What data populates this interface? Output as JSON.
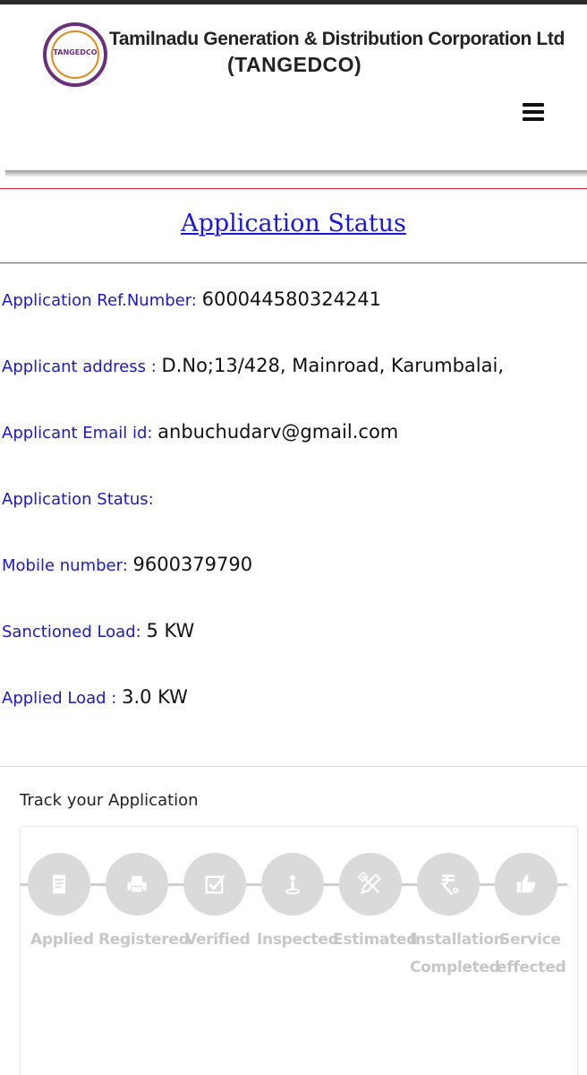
{
  "header": {
    "logo_text": "TANGEDCO",
    "org_name": "Tamilnadu Generation & Distribution Corporation Ltd",
    "org_abbr": "(TANGEDCO)"
  },
  "page": {
    "title": "Application Status"
  },
  "details": [
    {
      "label": "Application Ref.Number: ",
      "value": "600044580324241"
    },
    {
      "label": "Applicant address : ",
      "value": "D.No;13/428, Mainroad, Karumbalai,"
    },
    {
      "label": "Applicant Email id: ",
      "value": "anbuchudarv@gmail.com"
    },
    {
      "label": "Application Status: ",
      "value": ""
    },
    {
      "label": "Mobile number: ",
      "value": "9600379790"
    },
    {
      "label": "Sanctioned Load: ",
      "value": "5 KW"
    },
    {
      "label": "Applied Load : ",
      "value": "3.0 KW"
    }
  ],
  "tracker": {
    "title": "Track your Application",
    "steps": [
      {
        "label": "Applied",
        "icon": "document-icon"
      },
      {
        "label": "Registered",
        "icon": "printer-icon"
      },
      {
        "label": "Verified",
        "icon": "checkbox-icon"
      },
      {
        "label": "Inspected",
        "icon": "person-pin-icon"
      },
      {
        "label": "Estimated",
        "icon": "pencil-ruler-icon"
      },
      {
        "label": "Installation",
        "label2": "Completed",
        "icon": "rupee-icon"
      },
      {
        "label": "Service",
        "label2": "effected",
        "icon": "thumbs-up-icon"
      }
    ]
  },
  "colors": {
    "label_blue": "#1b1bc0",
    "title_blue": "#1a1ad6",
    "separator_red": "#d7262d",
    "step_gray": "#dadada",
    "step_text": "#c7c7c7"
  }
}
